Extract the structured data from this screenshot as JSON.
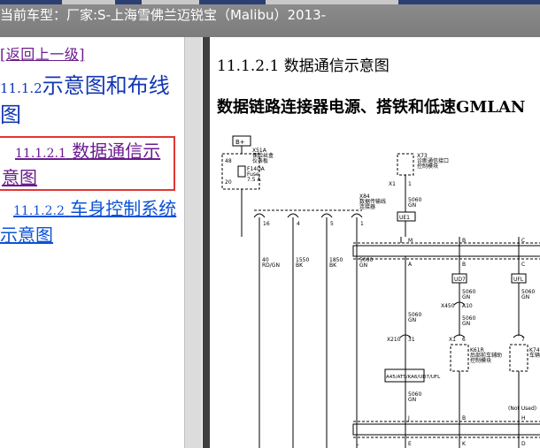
{
  "window": {
    "title": "当前车型：厂家:S-上海雪佛兰迈锐宝（Malibu）2013-"
  },
  "nav": {
    "back_label": "[返回上一级]",
    "section_num": "11.1.2",
    "section_title": "示意图和布线图",
    "items": [
      {
        "num": "11.1.2.1",
        "label": "数据通信示意图"
      },
      {
        "num": "11.1.2.2",
        "label": "车身控制系统示意图"
      }
    ]
  },
  "document": {
    "heading_num": "11.1.2.1",
    "heading": "数据通信示意图",
    "subheading": "数据链路连接器电源、搭铁和低速GMLAN"
  },
  "diagram": {
    "bplus": "B+",
    "x51a_label": "X51A",
    "x51a_desc1": "保险丝盒",
    "x51a_desc2": "仪表板",
    "pin48": "48",
    "fuse_name": "F14DA",
    "fuse_word": "Fuse",
    "fuse_amp": "7.5 A",
    "pin20": "20",
    "x73_label": "X73",
    "x73_desc1": "诊断通信接口",
    "x73_desc2": "控制模块",
    "x1_pin": "X1",
    "x1_num": "1",
    "x84_label": "X84",
    "x84_desc1": "数据传输线",
    "x84_desc2": "连接器",
    "wire_5060_1": "5060",
    "wire_gn_1": "GN",
    "ue1": "UE1",
    "dlc_pins": [
      "16",
      "4",
      "5",
      "1"
    ],
    "wire_labels": [
      {
        "num": "40",
        "color": "RD/GN"
      },
      {
        "num": "1550",
        "color": "BK"
      },
      {
        "num": "1850",
        "color": "BK"
      },
      {
        "num": "5060",
        "color": "GN"
      }
    ],
    "bus_letters_top": [
      "M",
      "B",
      "C"
    ],
    "bus_letters_mid": [
      "A",
      "B",
      "C"
    ],
    "ud7": "UD7",
    "ufl": "UFL",
    "x450": "X450",
    "a10": "A10",
    "wire_5060_a": "5060",
    "wire_gn_a": "GN",
    "wire_5060_b": "5060",
    "wire_gn_b": "GN",
    "wire_5060_c": "5060",
    "wire_gn_c": "GN",
    "wire_5060_d": "5060",
    "wire_gn_d": "GN",
    "wire_5060_e": "5060",
    "wire_gn_e": "GN",
    "x210": "X210",
    "x210_pin": "31",
    "k61r_x": "X1",
    "k61r_pin": "6",
    "k61r": "K61R",
    "k61r_desc1": "后部前车辅助",
    "k61r_desc2": "控制模块",
    "k74_pin": "7",
    "k74": "K74",
    "k74_desc": "车辆",
    "options": "A45/ATS/KA6/UD7/UFL",
    "not_used": "(Not Used)",
    "bus_letters_bottom_top": [
      "J",
      "B"
    ],
    "bus_letters_bottom": [
      "L",
      "E",
      "K",
      "D"
    ],
    "bus_letter_h": "H"
  }
}
